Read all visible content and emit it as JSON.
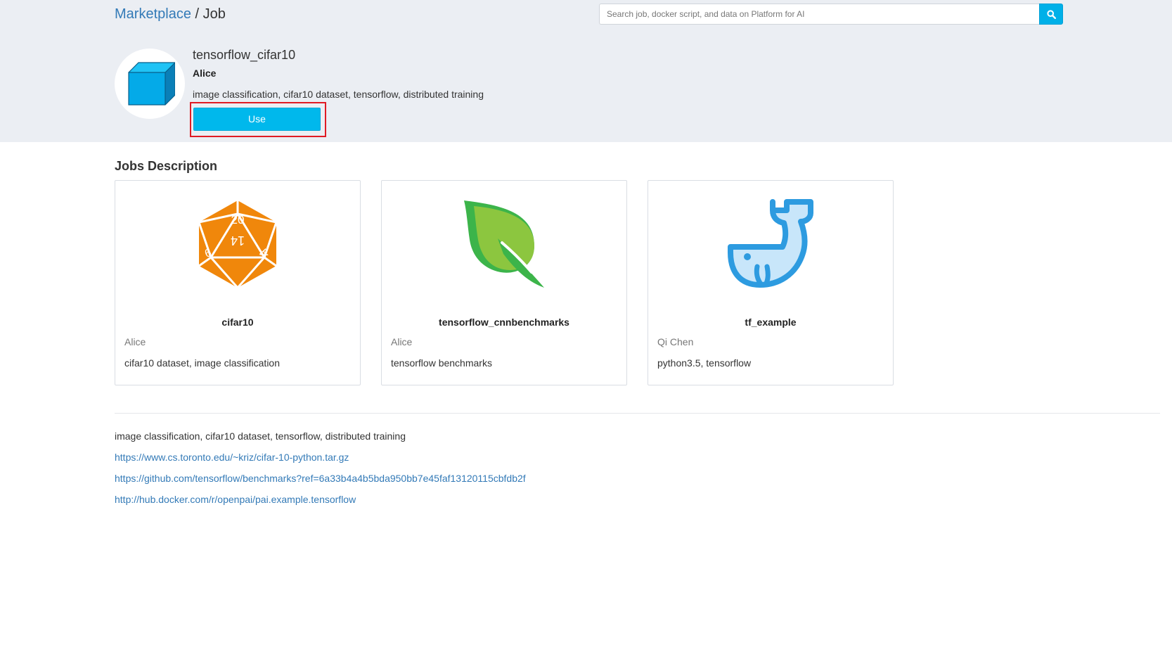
{
  "breadcrumb": {
    "root": "Marketplace",
    "separator": "/",
    "current": "Job"
  },
  "search": {
    "placeholder": "Search job, docker script, and data on Platform for AI",
    "button_icon": "search-icon"
  },
  "job": {
    "icon": "cube-icon",
    "title": "tensorflow_cifar10",
    "author": "Alice",
    "tags": "image classification, cifar10 dataset, tensorflow, distributed training",
    "use_label": "Use"
  },
  "section": {
    "title": "Jobs Description"
  },
  "cards": [
    {
      "icon": "d20-dice-icon",
      "name": "cifar10",
      "author": "Alice",
      "description": "cifar10 dataset, image classification"
    },
    {
      "icon": "leaf-icon",
      "name": "tensorflow_cnnbenchmarks",
      "author": "Alice",
      "description": "tensorflow benchmarks"
    },
    {
      "icon": "docker-whale-icon",
      "name": "tf_example",
      "author": "Qi Chen",
      "description": "python3.5, tensorflow"
    }
  ],
  "description": {
    "text": "image classification, cifar10 dataset, tensorflow, distributed training",
    "links": [
      "https://www.cs.toronto.edu/~kriz/cifar-10-python.tar.gz",
      "https://github.com/tensorflow/benchmarks?ref=6a33b4a4b5bda950bb7e45faf13120115cbfdb2f",
      "http://hub.docker.com/r/openpai/pai.example.tensorflow"
    ]
  },
  "colors": {
    "accent": "#00b8ec",
    "link": "#337ab7",
    "header_bg": "#ebeef3",
    "highlight": "#e01b24",
    "dice": "#f0870b",
    "leaf_dark": "#3cb44a",
    "leaf_light": "#8cc63f",
    "whale": "#2d9be0"
  }
}
